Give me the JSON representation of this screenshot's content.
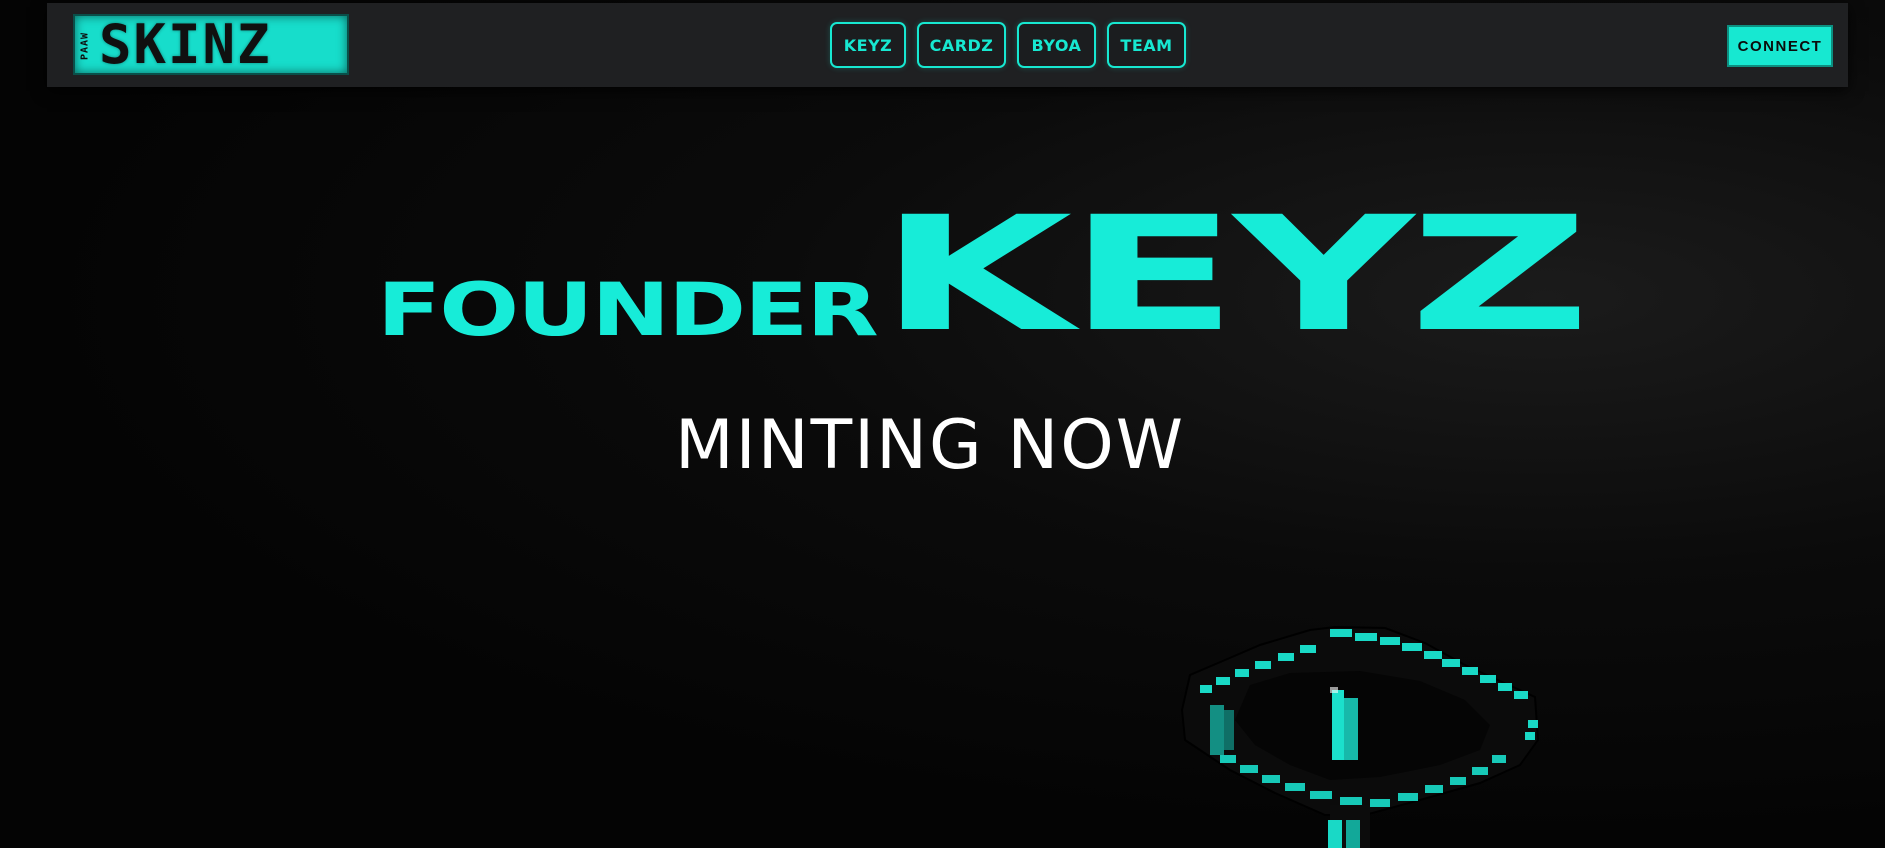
{
  "brand": {
    "logo_text": "SKINZ",
    "logo_small_text": "PAAW"
  },
  "nav": {
    "links": [
      {
        "label": "KEYZ"
      },
      {
        "label": "CARDZ"
      },
      {
        "label": "BYOA"
      },
      {
        "label": "TEAM"
      }
    ],
    "connect_label": "CONNECT"
  },
  "hero": {
    "title_small": "FOUNDER",
    "title_large": "KEYZ",
    "subtitle": "MINTING NOW"
  },
  "colors": {
    "accent": "#17ecd8",
    "navbar_bg": "#1f2022",
    "page_bg": "#050505",
    "subtitle": "#ffffff"
  },
  "icons": {
    "hero_art": "voxel-key-icon"
  }
}
